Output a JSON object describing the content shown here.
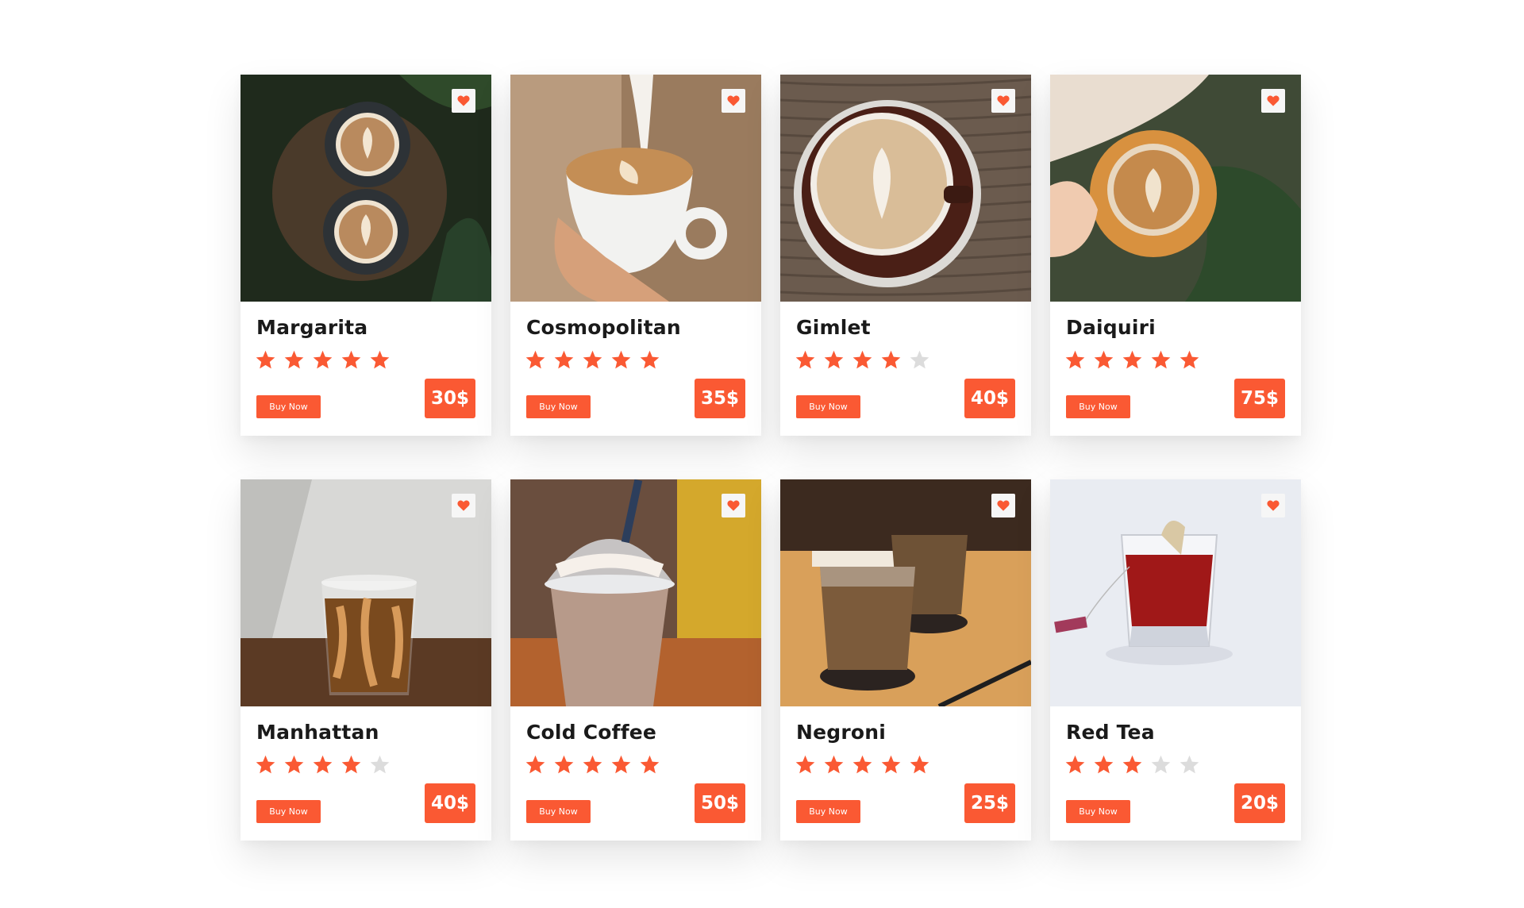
{
  "colors": {
    "accent": "#fa5933",
    "star_empty": "#dcdcdc",
    "text": "#1a1a1a"
  },
  "buy_label": "Buy Now",
  "products": [
    {
      "name": "Margarita",
      "rating": 5,
      "price": "30$",
      "photo": "two-latte-art-cups-on-wood-stump",
      "photo_bg": "#1f2a1c",
      "photo_main": "#b98a5e"
    },
    {
      "name": "Cosmopolitan",
      "rating": 5,
      "price": "35$",
      "photo": "milk-pouring-into-latte-cup",
      "photo_bg": "#8a6a4f",
      "photo_main": "#c48e55"
    },
    {
      "name": "Gimlet",
      "rating": 4,
      "price": "40$",
      "photo": "latte-in-brown-cup-on-wood",
      "photo_bg": "#6b5b4e",
      "photo_main": "#d9bd98"
    },
    {
      "name": "Daiquiri",
      "rating": 5,
      "price": "75$",
      "photo": "hands-holding-orange-latte-cup",
      "photo_bg": "#3f4a36",
      "photo_main": "#d8913f"
    },
    {
      "name": "Manhattan",
      "rating": 4,
      "price": "40$",
      "photo": "iced-coffee-glass-on-wood",
      "photo_bg": "#d8d8d6",
      "photo_main": "#7a4a1e"
    },
    {
      "name": "Cold Coffee",
      "rating": 5,
      "price": "50$",
      "photo": "frappe-cup-with-straw",
      "photo_bg": "#6a4e3e",
      "photo_main": "#b79a8a"
    },
    {
      "name": "Negroni",
      "rating": 5,
      "price": "25$",
      "photo": "two-iced-coffee-glasses",
      "photo_bg": "#c98e44",
      "photo_main": "#6e5236"
    },
    {
      "name": "Red Tea",
      "rating": 3,
      "price": "20$",
      "photo": "red-tea-glass-with-teabag",
      "photo_bg": "#e9ecf2",
      "photo_main": "#a01818"
    }
  ]
}
